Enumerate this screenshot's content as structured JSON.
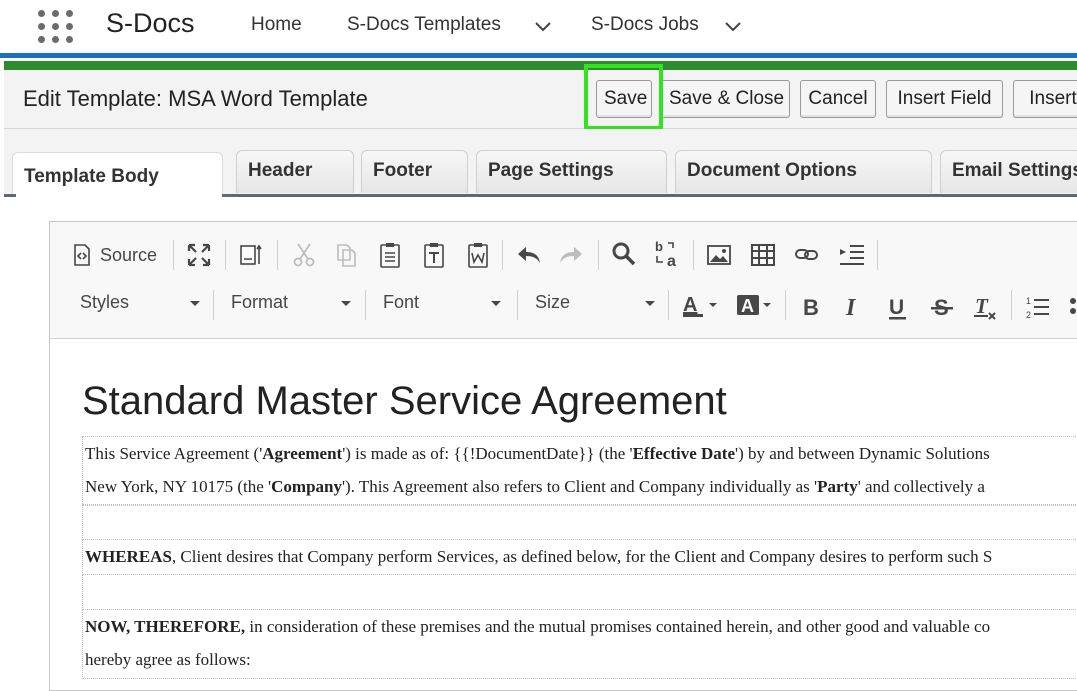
{
  "app": {
    "name": "S-Docs",
    "nav": [
      {
        "label": "Home",
        "has_menu": false
      },
      {
        "label": "S-Docs Templates",
        "has_menu": true
      },
      {
        "label": "S-Docs Jobs",
        "has_menu": true
      }
    ]
  },
  "header": {
    "title": "Edit Template: MSA Word Template",
    "buttons": {
      "save": "Save",
      "save_close": "Save & Close",
      "cancel": "Cancel",
      "insert_field": "Insert Field",
      "insert_more": "Insert"
    }
  },
  "tabs": [
    {
      "label": "Template Body",
      "active": true
    },
    {
      "label": "Header",
      "active": false
    },
    {
      "label": "Footer",
      "active": false
    },
    {
      "label": "Page Settings",
      "active": false
    },
    {
      "label": "Document Options",
      "active": false
    },
    {
      "label": "Email Settings",
      "active": false
    }
  ],
  "toolbar": {
    "source_label": "Source",
    "combos": {
      "styles": "Styles",
      "format": "Format",
      "font": "Font",
      "size": "Size"
    },
    "icons": [
      "source-icon",
      "maximize-icon",
      "show-blocks-icon",
      "cut-icon",
      "copy-icon",
      "paste-icon",
      "paste-text-icon",
      "paste-word-icon",
      "undo-icon",
      "redo-icon",
      "find-icon",
      "replace-icon",
      "image-icon",
      "table-icon",
      "link-icon",
      "indent-list-icon",
      "text-color-icon",
      "background-color-icon",
      "bold-icon",
      "italic-icon",
      "underline-icon",
      "strikethrough-icon",
      "remove-format-icon",
      "numbered-list-icon",
      "bulleted-list-icon"
    ]
  },
  "document": {
    "heading": "Standard Master Service Agreement",
    "p1_a": "This Service Agreement ('",
    "p1_b": "Agreement",
    "p1_c": "') is made as of: {{!DocumentDate}} (the '",
    "p1_d": "Effective Date",
    "p1_e": "') by and between Dynamic Solutions",
    "p1l2_a": "New York, NY 10175 (the '",
    "p1l2_b": "Company",
    "p1l2_c": "'). This Agreement also refers to Client and Company individually as '",
    "p1l2_d": "Party",
    "p1l2_e": "' and collectively a",
    "p2_a": "WHEREAS",
    "p2_b": ", Client desires that Company perform Services, as defined below, for the Client and Company desires to perform such S",
    "p3_a": "NOW, THEREFORE,",
    "p3_b": " in consideration of these premises and the mutual promises contained herein, and other good and valuable co",
    "p3l2": "hereby agree as follows:"
  },
  "colors": {
    "nav_blue": "#1b6ec2",
    "green_bar": "#2e8b2e",
    "highlight_green": "#33e31f",
    "tab_underline": "#5b6a7a"
  }
}
